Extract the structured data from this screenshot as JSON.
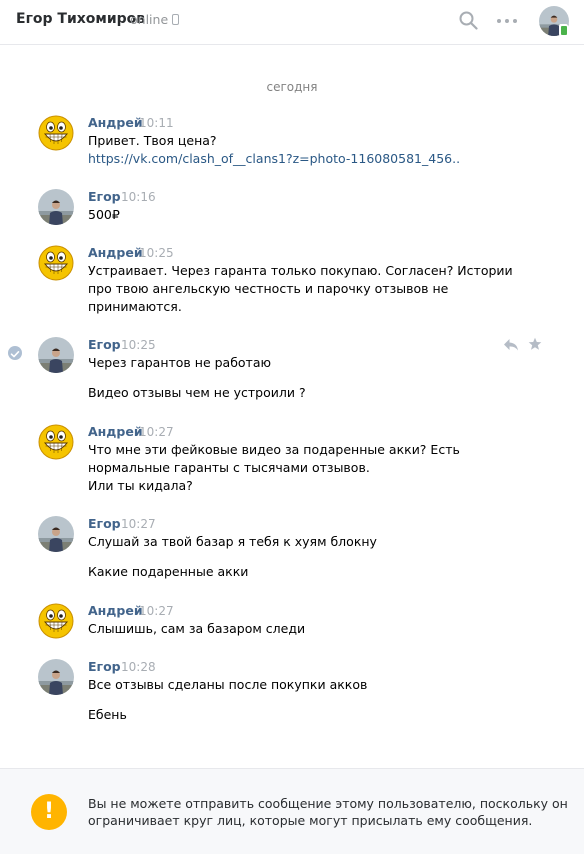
{
  "header": {
    "contact_name": "Егор Тихомиров",
    "status": "online"
  },
  "date_separator": "сегодня",
  "messages": [
    {
      "author": "Андрей",
      "time": "10:11",
      "lines": [
        "Привет. Твоя цена?"
      ],
      "link": "https://vk.com/clash_of__clans1?z=photo-116080581_456.."
    },
    {
      "author": "Егор",
      "time": "10:16",
      "lines": [
        "500₽"
      ]
    },
    {
      "author": "Андрей",
      "time": "10:25",
      "lines": [
        "Устраивает. Через гаранта только покупаю. Согласен? Истории",
        "про твою ангельскую честность и парочку отзывов не",
        "принимаются."
      ]
    },
    {
      "author": "Егор",
      "time": "10:25",
      "lines": [
        "Через гарантов не работаю",
        "Видео отзывы чем не устроили ?"
      ]
    },
    {
      "author": "Андрей",
      "time": "10:27",
      "lines": [
        "Что мне эти фейковые видео за подаренные акки? Есть",
        "нормальные гаранты с тысячами отзывов.",
        "Или ты кидала?"
      ]
    },
    {
      "author": "Егор",
      "time": "10:27",
      "lines": [
        "Слушай за твой базар я тебя к хуям блокну",
        "Какие подаренные акки"
      ]
    },
    {
      "author": "Андрей",
      "time": "10:27",
      "lines": [
        "Слышишь, сам за базаром следи"
      ]
    },
    {
      "author": "Егор",
      "time": "10:28",
      "lines": [
        "Все отзывы сделаны после покупки акков",
        "Ебень"
      ]
    }
  ],
  "footer": {
    "warning_symbol": "!",
    "notice_line1": "Вы не можете отправить сообщение этому пользователю, поскольку он",
    "notice_line2": "ограничивает круг лиц, которые могут присылать ему сообщения."
  },
  "colors": {
    "author": "#42648b",
    "link": "#2a5885",
    "warning": "#ffb400",
    "online": "#4bb34b"
  }
}
